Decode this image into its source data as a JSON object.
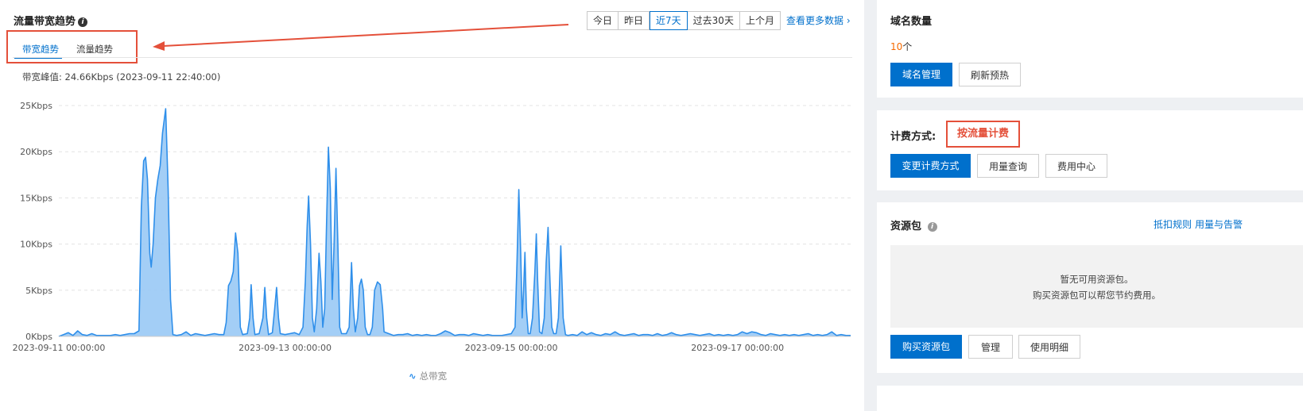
{
  "panel": {
    "title": "流量带宽趋势",
    "range_buttons": [
      "今日",
      "昨日",
      "近7天",
      "过去30天",
      "上个月"
    ],
    "active_range": "近7天",
    "more_link": "查看更多数据",
    "tabs": [
      "带宽趋势",
      "流量趋势"
    ],
    "active_tab": "带宽趋势",
    "peak_text": "带宽峰值: 24.66Kbps (2023-09-11 22:40:00)",
    "legend": "总带宽"
  },
  "chart_data": {
    "type": "area",
    "title": "",
    "xlabel": "",
    "ylabel": "",
    "y_ticks": [
      "0Kbps",
      "5Kbps",
      "10Kbps",
      "15Kbps",
      "20Kbps",
      "25Kbps"
    ],
    "x_ticks": [
      "2023-09-11 00:00:00",
      "2023-09-13 00:00:00",
      "2023-09-15 00:00:00",
      "2023-09-17 00:00:00"
    ],
    "ylim": [
      0,
      25
    ],
    "x_unit": "hours since 2023-09-11 00:00:00",
    "xlim": [
      0,
      168
    ],
    "color": "#2f8fea",
    "fill": "#99c9f5",
    "series": [
      {
        "name": "总带宽",
        "points": [
          [
            0,
            0
          ],
          [
            1,
            0.2
          ],
          [
            2,
            0.4
          ],
          [
            3,
            0.1
          ],
          [
            4,
            0.6
          ],
          [
            5,
            0.2
          ],
          [
            6,
            0.1
          ],
          [
            7,
            0.3
          ],
          [
            8,
            0.1
          ],
          [
            9,
            0.1
          ],
          [
            10,
            0.1
          ],
          [
            11,
            0.1
          ],
          [
            12,
            0.2
          ],
          [
            13,
            0.1
          ],
          [
            14,
            0.2
          ],
          [
            15,
            0.3
          ],
          [
            16,
            0.3
          ],
          [
            17,
            0.6
          ],
          [
            17.5,
            14
          ],
          [
            18,
            19
          ],
          [
            18.4,
            19.4
          ],
          [
            18.8,
            17
          ],
          [
            19.3,
            9
          ],
          [
            19.6,
            7.5
          ],
          [
            20,
            10
          ],
          [
            20.5,
            15
          ],
          [
            21,
            17
          ],
          [
            21.5,
            18.5
          ],
          [
            22,
            22
          ],
          [
            22.67,
            24.66
          ],
          [
            23.2,
            16
          ],
          [
            23.7,
            4
          ],
          [
            24.2,
            0.2
          ],
          [
            25,
            0.1
          ],
          [
            26,
            0.2
          ],
          [
            27,
            0.5
          ],
          [
            28,
            0.1
          ],
          [
            29,
            0.3
          ],
          [
            30,
            0.2
          ],
          [
            31,
            0.1
          ],
          [
            32,
            0.2
          ],
          [
            33,
            0.3
          ],
          [
            34,
            0.2
          ],
          [
            35,
            0.2
          ],
          [
            35.5,
            1.5
          ],
          [
            36,
            5.5
          ],
          [
            36.5,
            6
          ],
          [
            37,
            7
          ],
          [
            37.5,
            11.2
          ],
          [
            38,
            9
          ],
          [
            38.5,
            1
          ],
          [
            39,
            0.2
          ],
          [
            40,
            0.3
          ],
          [
            40.5,
            2
          ],
          [
            40.8,
            5.6
          ],
          [
            41.2,
            2
          ],
          [
            41.6,
            0.2
          ],
          [
            42.5,
            0.3
          ],
          [
            43.3,
            2
          ],
          [
            43.7,
            5.3
          ],
          [
            44.1,
            2
          ],
          [
            44.5,
            0.2
          ],
          [
            45.3,
            0.4
          ],
          [
            45.8,
            3
          ],
          [
            46.2,
            5.3
          ],
          [
            46.6,
            2
          ],
          [
            47,
            0.3
          ],
          [
            48,
            0.2
          ],
          [
            49,
            0.3
          ],
          [
            50,
            0.4
          ],
          [
            51,
            0.2
          ],
          [
            51.8,
            1
          ],
          [
            52.3,
            6
          ],
          [
            52.7,
            12
          ],
          [
            53,
            15.2
          ],
          [
            53.4,
            10
          ],
          [
            53.8,
            2
          ],
          [
            54.2,
            0.5
          ],
          [
            54.7,
            3
          ],
          [
            55.2,
            9
          ],
          [
            55.6,
            6
          ],
          [
            56,
            1
          ],
          [
            56.4,
            3
          ],
          [
            56.8,
            12
          ],
          [
            57.2,
            20.5
          ],
          [
            57.6,
            16
          ],
          [
            58,
            4
          ],
          [
            58.4,
            10
          ],
          [
            58.8,
            18.2
          ],
          [
            59.2,
            10
          ],
          [
            59.6,
            1
          ],
          [
            60,
            0.3
          ],
          [
            61,
            0.3
          ],
          [
            61.6,
            1
          ],
          [
            62.1,
            8
          ],
          [
            62.5,
            3
          ],
          [
            62.9,
            0.5
          ],
          [
            63.4,
            2
          ],
          [
            63.8,
            5.5
          ],
          [
            64.2,
            6.2
          ],
          [
            64.6,
            5
          ],
          [
            65,
            1
          ],
          [
            65.5,
            0.2
          ],
          [
            66,
            0.2
          ],
          [
            66.5,
            1
          ],
          [
            67,
            5
          ],
          [
            67.6,
            5.9
          ],
          [
            68.2,
            5.6
          ],
          [
            68.7,
            3
          ],
          [
            69,
            0.5
          ],
          [
            70,
            0.3
          ],
          [
            71,
            0.1
          ],
          [
            72,
            0.2
          ],
          [
            73,
            0.2
          ],
          [
            74,
            0.3
          ],
          [
            75,
            0.1
          ],
          [
            76,
            0.2
          ],
          [
            77,
            0.1
          ],
          [
            78,
            0.2
          ],
          [
            79,
            0.1
          ],
          [
            80,
            0.1
          ],
          [
            81,
            0.3
          ],
          [
            82,
            0.6
          ],
          [
            83,
            0.4
          ],
          [
            84,
            0.1
          ],
          [
            85,
            0.2
          ],
          [
            86,
            0.2
          ],
          [
            87,
            0.1
          ],
          [
            88,
            0.3
          ],
          [
            89,
            0.2
          ],
          [
            90,
            0.1
          ],
          [
            91,
            0.2
          ],
          [
            92,
            0.1
          ],
          [
            93,
            0.1
          ],
          [
            94,
            0.1
          ],
          [
            95,
            0.2
          ],
          [
            96,
            0.3
          ],
          [
            96.8,
            1
          ],
          [
            97.2,
            8
          ],
          [
            97.6,
            15.9
          ],
          [
            98,
            9
          ],
          [
            98.3,
            2
          ],
          [
            98.6,
            5
          ],
          [
            98.9,
            9.1
          ],
          [
            99.2,
            3
          ],
          [
            99.6,
            0.3
          ],
          [
            100,
            0.3
          ],
          [
            100.5,
            2
          ],
          [
            101,
            7
          ],
          [
            101.3,
            11.1
          ],
          [
            101.6,
            6
          ],
          [
            102,
            0.5
          ],
          [
            102.5,
            0.3
          ],
          [
            103,
            2
          ],
          [
            103.4,
            8
          ],
          [
            103.8,
            11.8
          ],
          [
            104.2,
            6
          ],
          [
            104.6,
            1
          ],
          [
            105,
            0.3
          ],
          [
            105.5,
            0.3
          ],
          [
            106,
            2
          ],
          [
            106.5,
            9.8
          ],
          [
            107,
            2
          ],
          [
            107.5,
            0.2
          ],
          [
            108,
            0.1
          ],
          [
            109,
            0.2
          ],
          [
            110,
            0.1
          ],
          [
            111,
            0.5
          ],
          [
            112,
            0.2
          ],
          [
            113,
            0.4
          ],
          [
            114,
            0.2
          ],
          [
            115,
            0.1
          ],
          [
            116,
            0.3
          ],
          [
            117,
            0.2
          ],
          [
            118,
            0.5
          ],
          [
            119,
            0.2
          ],
          [
            120,
            0.1
          ],
          [
            121,
            0.2
          ],
          [
            122,
            0.3
          ],
          [
            123,
            0.1
          ],
          [
            124,
            0.2
          ],
          [
            125,
            0.2
          ],
          [
            126,
            0.1
          ],
          [
            127,
            0.3
          ],
          [
            128,
            0.1
          ],
          [
            129,
            0.2
          ],
          [
            130,
            0.4
          ],
          [
            131,
            0.2
          ],
          [
            132,
            0.1
          ],
          [
            133,
            0.2
          ],
          [
            134,
            0.3
          ],
          [
            135,
            0.2
          ],
          [
            136,
            0.1
          ],
          [
            137,
            0.2
          ],
          [
            138,
            0.3
          ],
          [
            139,
            0.1
          ],
          [
            140,
            0.2
          ],
          [
            141,
            0.1
          ],
          [
            142,
            0.2
          ],
          [
            143,
            0.1
          ],
          [
            144,
            0.2
          ],
          [
            145,
            0.5
          ],
          [
            146,
            0.3
          ],
          [
            147,
            0.5
          ],
          [
            148,
            0.4
          ],
          [
            149,
            0.2
          ],
          [
            150,
            0.1
          ],
          [
            151,
            0.3
          ],
          [
            152,
            0.2
          ],
          [
            153,
            0.1
          ],
          [
            154,
            0.2
          ],
          [
            155,
            0.1
          ],
          [
            156,
            0.2
          ],
          [
            157,
            0.1
          ],
          [
            158,
            0.2
          ],
          [
            159,
            0.3
          ],
          [
            160,
            0.1
          ],
          [
            161,
            0.2
          ],
          [
            162,
            0.1
          ],
          [
            163,
            0.2
          ],
          [
            164,
            0.5
          ],
          [
            165,
            0.1
          ],
          [
            166,
            0.2
          ],
          [
            167,
            0.1
          ],
          [
            168,
            0.1
          ]
        ]
      }
    ]
  },
  "domain_card": {
    "title": "域名数量",
    "count_num": "10",
    "count_unit": "个",
    "manage_button": "域名管理",
    "refresh_button": "刷新预热"
  },
  "billing_card": {
    "label": "计费方式:",
    "value": "按流量计费",
    "change_button": "变更计费方式",
    "usage_button": "用量查询",
    "fee_button": "费用中心"
  },
  "package_card": {
    "title": "资源包",
    "rules_link": "抵扣规则",
    "alert_link": "用量与告警",
    "empty_line1": "暂无可用资源包。",
    "empty_line2": "购买资源包可以帮您节约费用。",
    "buy_button": "购买资源包",
    "manage_button": "管理",
    "detail_button": "使用明细"
  }
}
